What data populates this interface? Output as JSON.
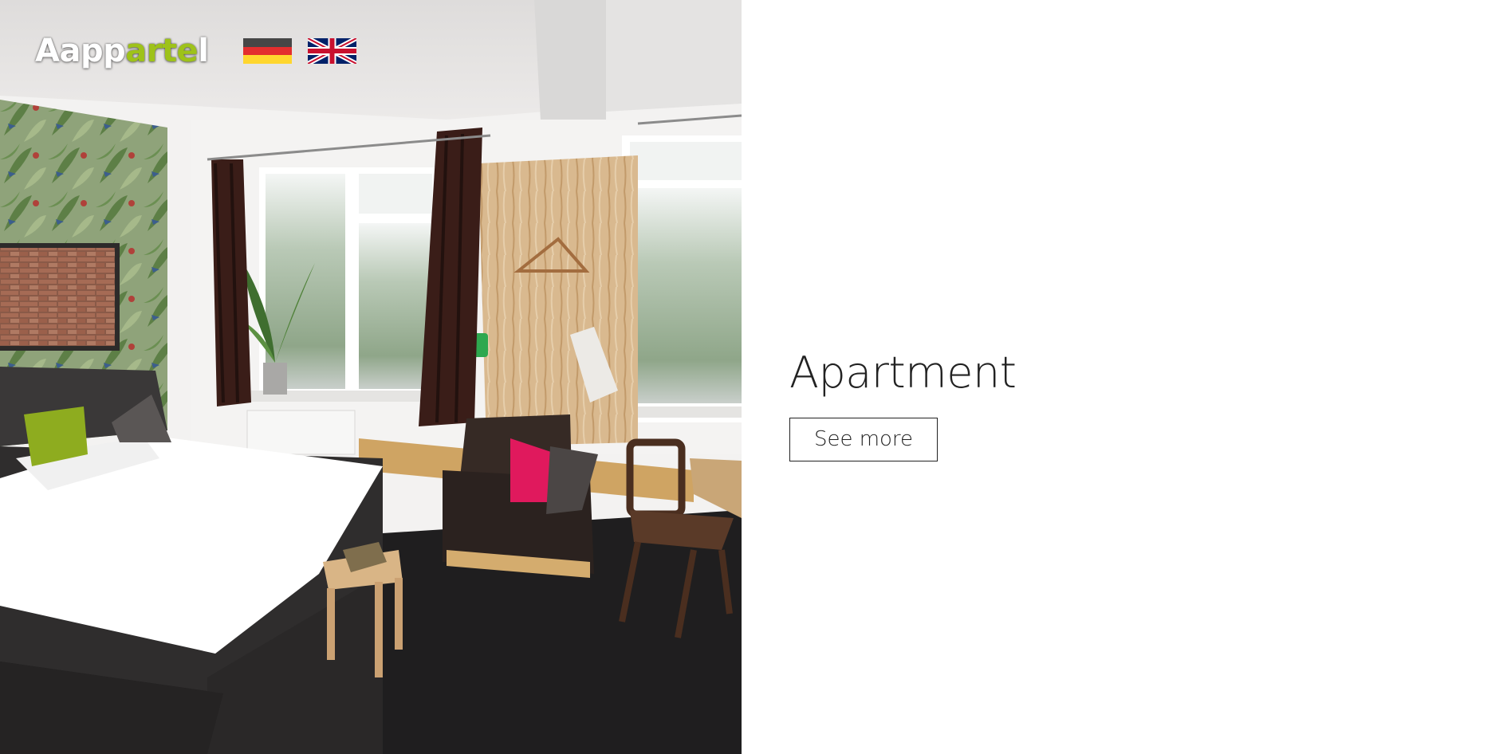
{
  "header": {
    "logo_part1": "Aapp",
    "logo_accent": "arte",
    "logo_part2": "l",
    "accent_color": "#9ec21a",
    "languages": [
      {
        "code": "de",
        "icon": "german-flag-icon"
      },
      {
        "code": "en",
        "icon": "uk-flag-icon"
      }
    ]
  },
  "main": {
    "title": "Apartment",
    "button_label": "See more"
  },
  "hero": {
    "image": "hotel-room-photo"
  }
}
